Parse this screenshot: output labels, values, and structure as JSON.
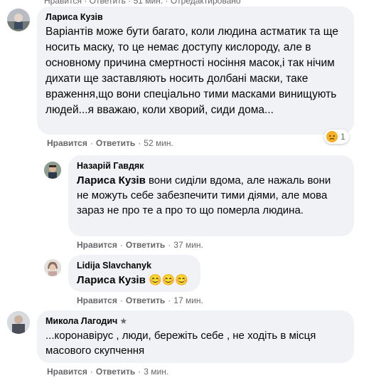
{
  "top_cut_text": "Нравится · Ответить · 51 мин. · Отредактировано",
  "comments": [
    {
      "author": "Лариса Кузів",
      "text": "Варіантів може бути багато, коли людина астматик та ще носить маску, то це немає доступу кислороду, але в основному причина смертності носіння масок,і так нічим дихати ще заставляють носить долбані маски, таке враження,що вони спеціально тими масками винищують людей...я вважаю, коли хворий, сиди дома...",
      "like": "Нравится",
      "reply": "Ответить",
      "time": "52 мин.",
      "reaction_count": "1",
      "reaction_icon": "sad-face-icon"
    },
    {
      "author": "Назарій Гавдяк",
      "mention": "Лариса Кузів",
      "text": " вони сиділи вдома, але нажаль вони не можуть себе забезпечити тими діями, але мова зараз не про те а про то що померла людина.",
      "like": "Нравится",
      "reply": "Ответить",
      "time": "37 мин."
    },
    {
      "author": "Lidija Slavchanyk",
      "mention": "Лариса Кузів",
      "emojis": "😊😊😊",
      "like": "Нравится",
      "reply": "Ответить",
      "time": "17 мин."
    },
    {
      "author": "Микола Лагодич",
      "badge_icon": "star-icon",
      "text": "...коронавірус , люди, бережіть себе , не ходіть в місця масового скупчення",
      "like": "Нравится",
      "reply": "Ответить",
      "time": "3 мин."
    }
  ],
  "colors": {
    "bubble": "#f0f2f5",
    "secondary_text": "#65676b",
    "primary_text": "#050505"
  }
}
